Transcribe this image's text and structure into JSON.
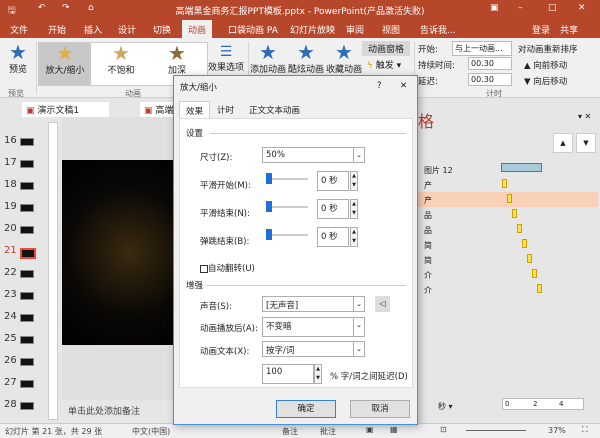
{
  "window": {
    "title": "高端黑金商务汇报PPT模板.pptx - PowerPoint(产品激活失败)"
  },
  "quick_access": {
    "save": "save-icon",
    "undo": "undo-icon",
    "redo": "redo-icon"
  },
  "tabs": [
    "文件",
    "开始",
    "插入",
    "设计",
    "切换",
    "动画",
    "口袋动画 PA",
    "幻灯片放映",
    "审阅",
    "视图",
    "告诉我..."
  ],
  "account": {
    "login": "登录",
    "share": "共享"
  },
  "ribbon": {
    "preview": "预览",
    "preview_group": "预览",
    "effects": [
      "放大/缩小",
      "不饱和",
      "加深"
    ],
    "animation_group": "动画",
    "effect_options": "效果选项",
    "add_animation": "添加动画",
    "cool_animation": "酷炫动画",
    "fav_animation": "收藏动画",
    "animation_pane": "动画窗格",
    "trigger": "触发",
    "start_label": "开始:",
    "start_value": "与上一动画...",
    "duration_label": "持续时间:",
    "duration_value": "00.30",
    "delay_label": "延迟:",
    "delay_value": "00.30",
    "reorder": "对动画重新排序",
    "move_earlier": "向前移动",
    "move_later": "向后移动",
    "timing_group": "计时"
  },
  "doc_tabs": [
    "演示文稿1",
    "高端"
  ],
  "thumbnails": {
    "numbers": [
      "16",
      "17",
      "18",
      "19",
      "20",
      "21",
      "22",
      "23",
      "24",
      "25",
      "26",
      "27",
      "28"
    ],
    "selected": "21"
  },
  "notes": "单击此处添加备注",
  "status": {
    "slide_info": "幻灯片 第 21 张，共 29 张",
    "language": "中文(中国)",
    "notes": "备注",
    "comments": "批注",
    "zoom": "37%"
  },
  "pane": {
    "title": "格",
    "items": [
      "图片 12",
      "产",
      "产",
      "品",
      "品",
      "简",
      "简",
      "介",
      "介"
    ],
    "selected_index": 2,
    "seconds": "秒",
    "ticks": [
      "0",
      "2",
      "4"
    ]
  },
  "dialog": {
    "title": "放大/缩小",
    "help": "?",
    "close": "✕",
    "tabs": [
      "效果",
      "计时",
      "正文文本动画"
    ],
    "settings_header": "设置",
    "size_label": "尺寸(Z):",
    "size_value": "50%",
    "smooth_start_label": "平滑开始(M):",
    "smooth_start_value": "0 秒",
    "smooth_end_label": "平滑结束(N):",
    "smooth_end_value": "0 秒",
    "bounce_end_label": "弹跳结束(B):",
    "bounce_end_value": "0 秒",
    "auto_reverse": "自动翻转(U)",
    "enhance_header": "增强",
    "sound_label": "声音(S):",
    "sound_value": "[无声音]",
    "after_label": "动画播放后(A):",
    "after_value": "不变暗",
    "text_label": "动画文本(X):",
    "text_value": "按字/词",
    "delay_value": "100",
    "delay_label": "% 字/词之间延迟(D)",
    "ok": "确定",
    "cancel": "取消"
  }
}
